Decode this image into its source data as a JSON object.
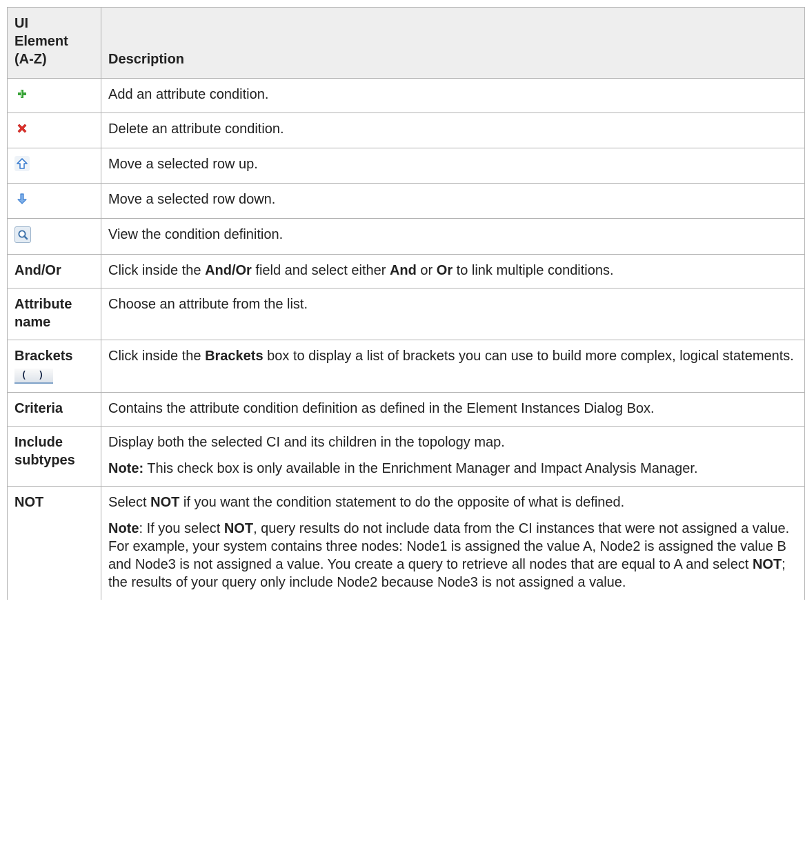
{
  "header": {
    "col1_lines": [
      "UI",
      "Element",
      "(A-Z)"
    ],
    "col2": "Description"
  },
  "icon_rows": [
    {
      "icon": "add-icon",
      "description": "Add an attribute condition."
    },
    {
      "icon": "delete-icon",
      "description": "Delete an attribute condition."
    },
    {
      "icon": "move-up-icon",
      "description": "Move a selected row up."
    },
    {
      "icon": "move-down-icon",
      "description": "Move a selected row down."
    },
    {
      "icon": "view-condition-icon",
      "description": "View the condition definition."
    }
  ],
  "and_or": {
    "name": "And/Or",
    "t1": "Click inside the ",
    "b1": "And/Or",
    "t2": " field and select either ",
    "b2": "And",
    "t3": " or ",
    "b3": "Or",
    "t4": " to link multiple conditions."
  },
  "attribute_name": {
    "name_lines": [
      "Attribute",
      "name"
    ],
    "description": "Choose an attribute from the list."
  },
  "brackets": {
    "name": "Brackets",
    "button_glyph": "( )",
    "t1": "Click inside the ",
    "b1": "Brackets",
    "t2": " box to display a list of brackets you can use to build more complex, logical statements."
  },
  "criteria": {
    "name": "Criteria",
    "description": "Contains the attribute condition definition as defined in the Element Instances Dialog Box."
  },
  "include_subtypes": {
    "name_lines": [
      "Include",
      "subtypes"
    ],
    "description": "Display both the selected CI and its children in the topology map.",
    "note_label": "Note:",
    "note_text": " This check box is only available in the Enrichment Manager and Impact Analysis Manager."
  },
  "not": {
    "name": "NOT",
    "p1_t1": "Select ",
    "p1_b1": "NOT",
    "p1_t2": " if you want the condition statement to do the opposite of what is defined.",
    "note_label": "Note",
    "p2_t1": ": If you select ",
    "p2_b1": "NOT",
    "p2_t2": ", query results do not include data from the CI instances that were not assigned a value. For example, your system contains three nodes: Node1 is assigned the value A, Node2 is assigned the value B and Node3 is not assigned a value. You create a query to retrieve all nodes that are equal to A and select ",
    "p2_b2": "NOT",
    "p2_t3": "; the results of your query only include Node2 because Node3 is not assigned a value."
  },
  "colors": {
    "header_bg": "#eeeeee",
    "border": "#b3b3b3",
    "add_green": "#3aa33a",
    "delete_red": "#e0302a",
    "arrow_blue": "#3d7fd1"
  }
}
